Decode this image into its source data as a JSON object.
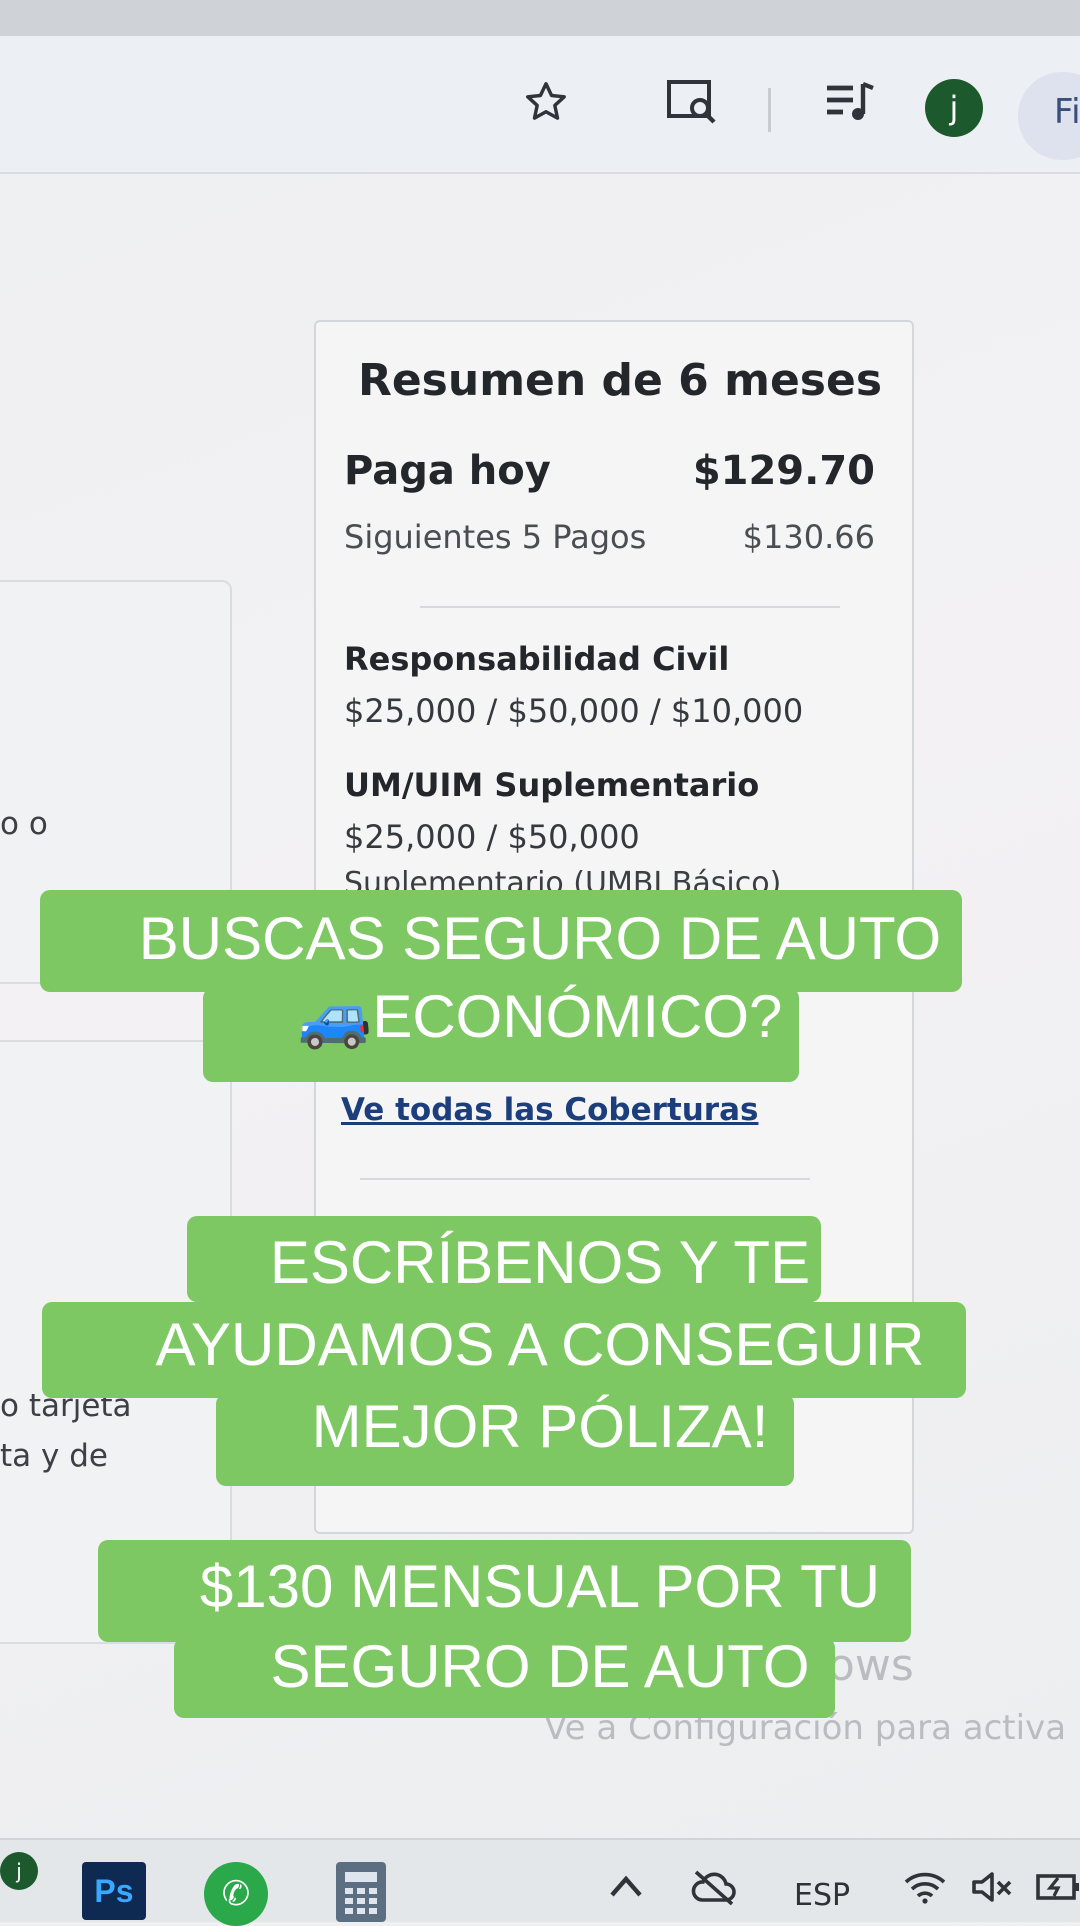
{
  "browser": {
    "avatar_letter": "j",
    "pill_text": "Fi"
  },
  "background": {
    "left_fragment_1": "o o",
    "left_fragment_2": "o tarjeta",
    "left_fragment_3": "ta y de"
  },
  "summary": {
    "title": "Resumen de 6 meses",
    "pay_today_label": "Paga hoy",
    "pay_today_value": "$129.70",
    "next_payments_label": "Siguientes 5 Pagos",
    "next_payments_value": "$130.66",
    "coverages": [
      {
        "title": "Responsabilidad Civil",
        "value": "$25,000 / $50,000 / $10,000"
      },
      {
        "title": "UM/UIM Suplementario",
        "value": "$25,000 / $50,000",
        "note": "Suplementario (UMBI Básico)"
      }
    ],
    "view_all_link": "Ve todas las Coberturas"
  },
  "watermark": {
    "line1": "dows",
    "line2": "Ve a Configuración para activa"
  },
  "captions": {
    "caption1_line1": "BUSCAS SEGURO DE AUTO",
    "caption1_line2": "🚙ECONÓMICO?",
    "caption2_line1": "ESCRÍBENOS Y TE",
    "caption2_line2": "AYUDAMOS A CONSEGUIR",
    "caption2_line3": "MEJOR PÓLIZA!",
    "caption3_line1": "$130 MENSUAL POR TU",
    "caption3_line2": "SEGURO DE AUTO"
  },
  "taskbar": {
    "ps_label": "Ps",
    "language": "ESP"
  }
}
